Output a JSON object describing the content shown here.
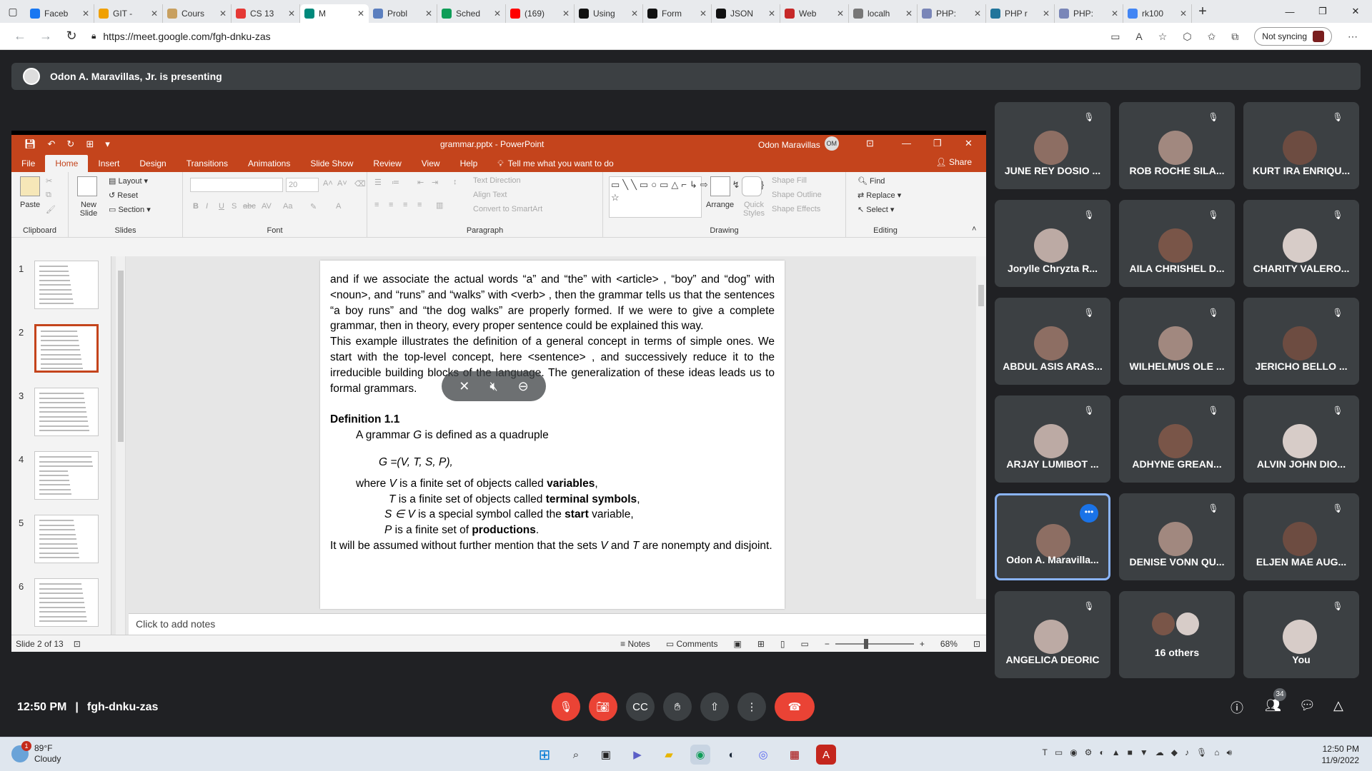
{
  "browser": {
    "tabs": [
      {
        "label": "Faceb",
        "color": "#1877f2",
        "active": false
      },
      {
        "label": "GIT - ",
        "color": "#f0a000",
        "active": false
      },
      {
        "label": "Cours",
        "color": "#c8a060",
        "active": false
      },
      {
        "label": "CS 13",
        "color": "#e53935",
        "active": false
      },
      {
        "label": "M",
        "color": "#00897b",
        "active": true
      },
      {
        "label": "Probl",
        "color": "#5b7fbf",
        "active": false
      },
      {
        "label": "Sched",
        "color": "#0f9d58",
        "active": false
      },
      {
        "label": "(169)",
        "color": "#ff0000",
        "active": false
      },
      {
        "label": "Using",
        "color": "#111111",
        "active": false
      },
      {
        "label": "Form",
        "color": "#111111",
        "active": false
      },
      {
        "label": "JSON",
        "color": "#111111",
        "active": false
      },
      {
        "label": "Web",
        "color": "#c62828",
        "active": false
      },
      {
        "label": "localh",
        "color": "#777777",
        "active": false
      },
      {
        "label": "PHP: ",
        "color": "#7a86b8",
        "active": false
      },
      {
        "label": "PHP r",
        "color": "#21759b",
        "active": false
      },
      {
        "label": "PHP: ",
        "color": "#7a86b8",
        "active": false
      },
      {
        "label": "rk100",
        "color": "#4285f4",
        "active": false
      }
    ],
    "url": "https://meet.google.com/fgh-dnku-zas",
    "sync_label": "Not syncing"
  },
  "meet": {
    "presenting_text": "Odon A. Maravillas, Jr. is presenting",
    "time": "12:50 PM",
    "meeting_code": "fgh-dnku-zas",
    "participant_count": "34",
    "tiles": [
      {
        "name": "JUNE REY DOSIO ...",
        "col": 0,
        "row": 0
      },
      {
        "name": "ROB ROCHE SILA...",
        "col": 1,
        "row": 0
      },
      {
        "name": "KURT IRA ENRIQU...",
        "col": 2,
        "row": 0
      },
      {
        "name": "Jorylle Chryzta R...",
        "col": 0,
        "row": 1
      },
      {
        "name": "AILA CHRISHEL D...",
        "col": 1,
        "row": 1
      },
      {
        "name": "CHARITY VALERO...",
        "col": 2,
        "row": 1
      },
      {
        "name": "ABDUL ASIS ARAS...",
        "col": 0,
        "row": 2
      },
      {
        "name": "WILHELMUS OLE ...",
        "col": 1,
        "row": 2
      },
      {
        "name": "JERICHO BELLO ...",
        "col": 2,
        "row": 2
      },
      {
        "name": "ARJAY LUMIBOT ...",
        "col": 0,
        "row": 3
      },
      {
        "name": "ADHYNE GREAN...",
        "col": 1,
        "row": 3
      },
      {
        "name": "ALVIN JOHN DIO...",
        "col": 2,
        "row": 3
      },
      {
        "name": "Odon A. Maravilla...",
        "col": 0,
        "row": 4,
        "speaking": true
      },
      {
        "name": "DENISE VONN QU...",
        "col": 1,
        "row": 4
      },
      {
        "name": "ELJEN MAE AUG...",
        "col": 2,
        "row": 4
      },
      {
        "name": "ANGELICA DEORIC",
        "col": 0,
        "row": 5
      },
      {
        "name": "16 others",
        "col": 1,
        "row": 5,
        "group": true
      },
      {
        "name": "You",
        "col": 2,
        "row": 5
      }
    ]
  },
  "ppt": {
    "doc_title": "grammar.pptx - PowerPoint",
    "user": "Odon Maravillas",
    "user_initials": "OM",
    "ribbon_tabs": [
      "File",
      "Home",
      "Insert",
      "Design",
      "Transitions",
      "Animations",
      "Slide Show",
      "Review",
      "View",
      "Help"
    ],
    "tell_me": "Tell me what you want to do",
    "share": "Share",
    "groups": {
      "clipboard": "Clipboard",
      "slides": "Slides",
      "font": "Font",
      "paragraph": "Paragraph",
      "drawing": "Drawing",
      "editing": "Editing"
    },
    "buttons": {
      "paste": "Paste",
      "new_slide": "New Slide",
      "layout": "Layout",
      "reset": "Reset",
      "section": "Section",
      "font_size": "20",
      "text_direction": "Text Direction",
      "align_text": "Align Text",
      "convert_smartart": "Convert to SmartArt",
      "arrange": "Arrange",
      "quick_styles": "Quick Styles",
      "shape_fill": "Shape Fill",
      "shape_outline": "Shape Outline",
      "shape_effects": "Shape Effects",
      "find": "Find",
      "replace": "Replace",
      "select": "Select"
    },
    "slide_numbers": [
      "1",
      "2",
      "3",
      "4",
      "5",
      "6"
    ],
    "slide_text": {
      "p1": "and if we associate the actual words “a” and “the” with <article> ,  “boy” and “dog” with <noun>, and “runs” and “walks” with <verb> , then the grammar tells us that the sentences “a boy runs” and “the dog walks” are properly formed. If we were to give a complete grammar, then in theory, every proper sentence could be explained this way.",
      "p2": "This example illustrates the definition of a general concept in terms of simple ones. We start with the top-level concept, here <sentence> , and successively reduce it to the irreducible building blocks of the language. The generalization of these ideas leads us to formal grammars.",
      "def_heading": "Definition 1.1",
      "def_intro_a": "A grammar ",
      "def_intro_g": "G",
      "def_intro_b": " is defined as a quadruple",
      "tuple": "G =(V, T, S, P),",
      "where_a": "where ",
      "where_v": "V",
      "where_b": " is a finite set of objects called ",
      "where_bold": "variables",
      "where_c": ",",
      "t_var": "T",
      "t_text": " is a finite set of objects called ",
      "t_bold": "terminal symbols",
      "t_end": ",",
      "s_var": "S ∈ V",
      "s_text": " is a special symbol called the ",
      "s_bold": "start",
      "s_end": " variable,",
      "p_var": "P",
      "p_text": " is a finite set of ",
      "p_bold": "productions",
      "p_end": ".",
      "final_a": "It will be assumed without further mention that the sets ",
      "final_v": "V",
      "final_b": " and ",
      "final_t": "T",
      "final_c": " are nonempty and disjoint."
    },
    "notes_placeholder": "Click to add notes",
    "status": "Slide 2 of 13",
    "notes_label": "Notes",
    "comments_label": "Comments",
    "zoom": "68%"
  },
  "taskbar": {
    "temp": "89°F",
    "condition": "Cloudy",
    "weather_badge": "1",
    "time": "12:50 PM",
    "date": "11/9/2022"
  }
}
